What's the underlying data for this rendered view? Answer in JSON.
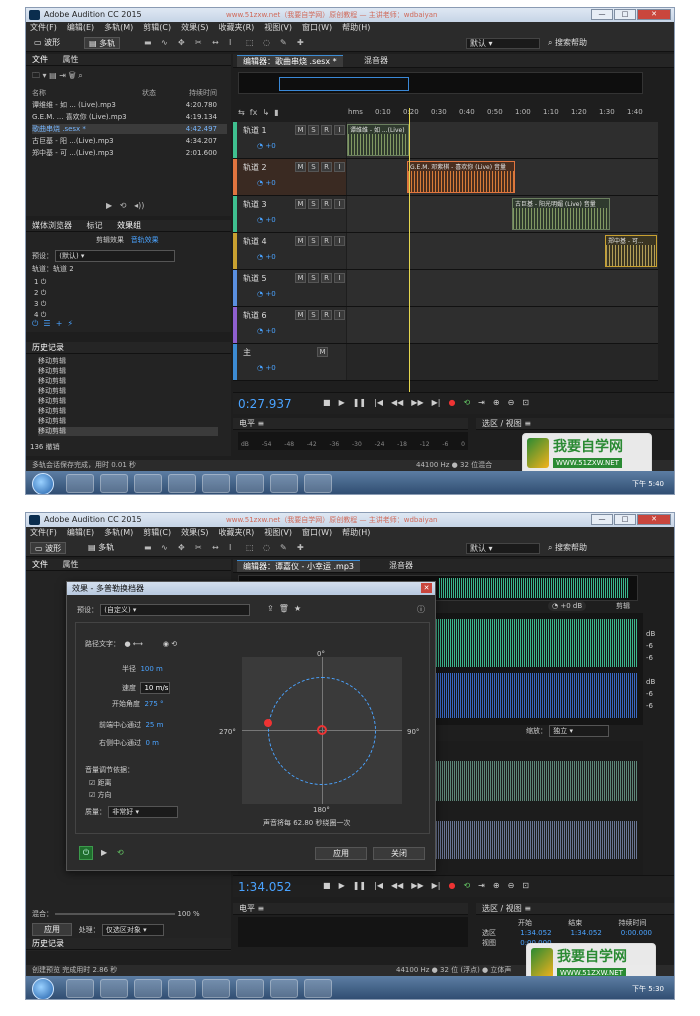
{
  "app_title": "Adobe Audition CC 2015",
  "title_url": "www.51zxw.net（我要自学网）原创教程 — 主讲老师：wdbaiyan",
  "win_controls": {
    "min": "—",
    "max": "□",
    "close": "✕"
  },
  "menu": [
    "文件(F)",
    "编辑(E)",
    "多轨(M)",
    "剪辑(C)",
    "效果(S)",
    "收藏夹(R)",
    "视图(V)",
    "窗口(W)",
    "帮助(H)"
  ],
  "toolbar": {
    "waveform_label": "波形",
    "multitrack_label": "多轨",
    "workspace": "默认",
    "search_help": "搜索帮助"
  },
  "shot1": {
    "files_tab": "文件",
    "props_tab": "属性",
    "file_columns": {
      "name": "名称",
      "status": "状态",
      "duration": "持续时间"
    },
    "files": [
      {
        "name": "谭维维 - 如 ... (Live).mp3",
        "duration": "4:20.780",
        "selected": false
      },
      {
        "name": "G.E.M. ... 喜欢你 (Live).mp3",
        "duration": "4:19.134",
        "selected": false
      },
      {
        "name": "歌曲串烧 .sesx *",
        "duration": "4:42.497",
        "selected": true
      },
      {
        "name": "古巨基 - 阳 ...(Live).mp3",
        "duration": "4:34.207",
        "selected": false
      },
      {
        "name": "郑中基 - 可 ...(Live).mp3",
        "duration": "2:01.600",
        "selected": false
      }
    ],
    "browser_tabs": [
      "媒体浏览器",
      "标记",
      "效果组"
    ],
    "fx_subtabs": [
      "剪辑效果",
      "音轨效果"
    ],
    "preset_label": "预设：",
    "preset_value": "(默认)",
    "track_label": "轨道：轨道 2",
    "fx_slots": [
      "1",
      "2",
      "3",
      "4"
    ],
    "history_title": "历史记录",
    "history_items": [
      "移动剪辑",
      "移动剪辑",
      "移动剪辑",
      "移动剪辑",
      "移动剪辑",
      "移动剪辑",
      "移动剪辑",
      "移动剪辑"
    ],
    "undo_count": "136 撤销",
    "editor_tab": "编辑器：歌曲串烧 .sesx *",
    "mixer_tab": "混音器",
    "ruler": [
      "hms",
      "0:10",
      "0:20",
      "0:30",
      "0:40",
      "0:50",
      "1:00",
      "1:10",
      "1:20",
      "1:30",
      "1:40"
    ],
    "tracks": [
      {
        "name": "轨道 1",
        "vol": "+0",
        "color": "#3fbf8f",
        "clip": "谭维维 - 如 ...(Live)"
      },
      {
        "name": "轨道 2",
        "vol": "+0",
        "color": "#e0743f",
        "clip": "G.E.M. 邓紫棋 - 喜欢你 (Live)  音量"
      },
      {
        "name": "轨道 3",
        "vol": "+0",
        "color": "#3fbf8f",
        "clip": "古巨基 - 阳光明媚 (Live)  音量"
      },
      {
        "name": "轨道 4",
        "vol": "+0",
        "color": "#c8a030",
        "clip": "郑中基 - 可..."
      },
      {
        "name": "轨道 5",
        "vol": "+0",
        "color": "#5a8fe0",
        "clip": ""
      },
      {
        "name": "轨道 6",
        "vol": "+0",
        "color": "#8f5fcf",
        "clip": ""
      },
      {
        "name": "主",
        "vol": "+0",
        "color": "#3c8bd3",
        "clip": ""
      }
    ],
    "timecode": "0:27.937",
    "level_title": "电平",
    "selview_title": "选区 / 视图",
    "meter_scale": [
      "dB",
      "-54",
      "-48",
      "-42",
      "-36",
      "-30",
      "-24",
      "-18",
      "-12",
      "-6",
      "0"
    ],
    "status": "多轨会话保存完成，用时 0.01 秒",
    "status_right": "44100 Hz ● 32 位混合",
    "clock": "下午 5:40"
  },
  "shot2": {
    "editor_tab": "编辑器：谭嘉仪 - 小幸运 .mp3",
    "mixer_tab": "混音器",
    "dialog_title": "效果 - 多普勒换档器",
    "preset_label": "预设：",
    "preset_value": "(自定义)",
    "path_label": "路径文字：",
    "radius_label": "半径",
    "radius_value": "100 m",
    "speed_label": "速度",
    "speed_value": "10 m/s",
    "angle_label": "开始角度",
    "angle_value": "275 °",
    "front_label": "前端中心通过",
    "front_value": "25 m",
    "right_label": "右侧中心通过",
    "right_value": "0 m",
    "adjust_label": "音量调节依据：",
    "distance_label": "距离",
    "direction_label": "方向",
    "quality_label": "质量：",
    "quality_value": "非常好",
    "deg0": "0°",
    "deg90": "90°",
    "deg180": "180°",
    "deg270": "270°",
    "note": "声音将每 62.80 秒绕圈一次",
    "apply": "应用",
    "close": "关闭",
    "db_badge": "+0 dB",
    "view_label": "剪辑",
    "zoom_label": "缩放：",
    "zoom_value": "独立",
    "timecode": "1:34.052",
    "level_title": "电平",
    "selview_title": "选区 / 视图",
    "sel_cols": {
      "start": "开始",
      "end": "结束",
      "duration": "持续时间"
    },
    "sel_label": "选区",
    "view_label2": "视图",
    "sel_start": "1:34.052",
    "sel_end": "1:34.052",
    "sel_dur": "0:00.000",
    "view_start": "0:00.000",
    "mix_label": "混合：",
    "mix_value": "100 %",
    "process_label": "处理：",
    "process_value": "仅选区对象",
    "apply2": "应用",
    "history_title": "历史记录",
    "status": "创建预览 完成用时 2.86 秒",
    "status_right": "44100 Hz ● 32 位 (浮点) ● 立体声",
    "clock": "下午 5:30"
  },
  "watermark": {
    "big": "我要自学网",
    "url": "WWW.51ZXW.NET"
  }
}
